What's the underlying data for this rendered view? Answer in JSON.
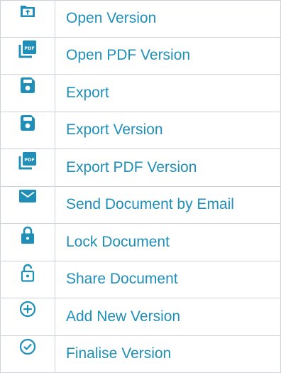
{
  "accent_color": "#1f8fb8",
  "items": [
    {
      "label": "Open Version",
      "icon": "folder-upload-icon"
    },
    {
      "label": "Open PDF Version",
      "icon": "pdf-file-icon"
    },
    {
      "label": "Export",
      "icon": "save-icon"
    },
    {
      "label": "Export Version",
      "icon": "save-icon"
    },
    {
      "label": "Export PDF Version",
      "icon": "pdf-file-icon"
    },
    {
      "label": "Send Document by Email",
      "icon": "envelope-icon"
    },
    {
      "label": "Lock Document",
      "icon": "lock-icon"
    },
    {
      "label": "Share Document",
      "icon": "unlock-icon"
    },
    {
      "label": "Add New Version",
      "icon": "add-circle-icon"
    },
    {
      "label": "Finalise Version",
      "icon": "check-circle-icon"
    }
  ]
}
